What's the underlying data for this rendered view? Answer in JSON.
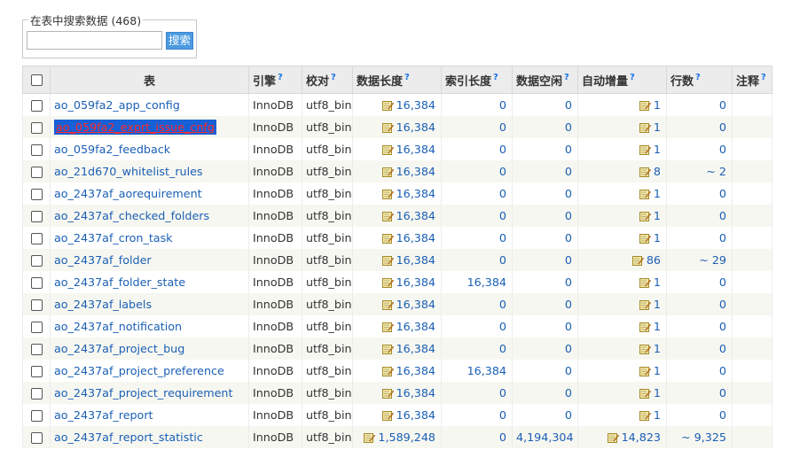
{
  "search": {
    "legend": "在表中搜索数据 (468)",
    "input_value": "",
    "button_label": "搜索"
  },
  "table": {
    "headers": {
      "table": "表",
      "engine": "引擎",
      "collation": "校对",
      "data_length": "数据长度",
      "index_length": "索引长度",
      "data_free": "数据空闲",
      "auto_increment": "自动增量",
      "rows": "行数",
      "comment": "注释"
    },
    "help_mark": "?",
    "rows": [
      {
        "name": "ao_059fa2_app_config",
        "engine": "InnoDB",
        "collation": "utf8_bin",
        "data_length": "16,384",
        "index_length": "0",
        "data_free": "0",
        "auto_increment": "1",
        "rows": "0"
      },
      {
        "name": "ao_059fa2_exprt_issue_cnfg",
        "engine": "InnoDB",
        "collation": "utf8_bin",
        "data_length": "16,384",
        "index_length": "0",
        "data_free": "0",
        "auto_increment": "1",
        "rows": "0"
      },
      {
        "name": "ao_059fa2_feedback",
        "engine": "InnoDB",
        "collation": "utf8_bin",
        "data_length": "16,384",
        "index_length": "0",
        "data_free": "0",
        "auto_increment": "1",
        "rows": "0"
      },
      {
        "name": "ao_21d670_whitelist_rules",
        "engine": "InnoDB",
        "collation": "utf8_bin",
        "data_length": "16,384",
        "index_length": "0",
        "data_free": "0",
        "auto_increment": "8",
        "rows": "~ 2"
      },
      {
        "name": "ao_2437af_aorequirement",
        "engine": "InnoDB",
        "collation": "utf8_bin",
        "data_length": "16,384",
        "index_length": "0",
        "data_free": "0",
        "auto_increment": "1",
        "rows": "0"
      },
      {
        "name": "ao_2437af_checked_folders",
        "engine": "InnoDB",
        "collation": "utf8_bin",
        "data_length": "16,384",
        "index_length": "0",
        "data_free": "0",
        "auto_increment": "1",
        "rows": "0"
      },
      {
        "name": "ao_2437af_cron_task",
        "engine": "InnoDB",
        "collation": "utf8_bin",
        "data_length": "16,384",
        "index_length": "0",
        "data_free": "0",
        "auto_increment": "1",
        "rows": "0"
      },
      {
        "name": "ao_2437af_folder",
        "engine": "InnoDB",
        "collation": "utf8_bin",
        "data_length": "16,384",
        "index_length": "0",
        "data_free": "0",
        "auto_increment": "86",
        "rows": "~ 29"
      },
      {
        "name": "ao_2437af_folder_state",
        "engine": "InnoDB",
        "collation": "utf8_bin",
        "data_length": "16,384",
        "index_length": "16,384",
        "data_free": "0",
        "auto_increment": "1",
        "rows": "0"
      },
      {
        "name": "ao_2437af_labels",
        "engine": "InnoDB",
        "collation": "utf8_bin",
        "data_length": "16,384",
        "index_length": "0",
        "data_free": "0",
        "auto_increment": "1",
        "rows": "0"
      },
      {
        "name": "ao_2437af_notification",
        "engine": "InnoDB",
        "collation": "utf8_bin",
        "data_length": "16,384",
        "index_length": "0",
        "data_free": "0",
        "auto_increment": "1",
        "rows": "0"
      },
      {
        "name": "ao_2437af_project_bug",
        "engine": "InnoDB",
        "collation": "utf8_bin",
        "data_length": "16,384",
        "index_length": "0",
        "data_free": "0",
        "auto_increment": "1",
        "rows": "0"
      },
      {
        "name": "ao_2437af_project_preference",
        "engine": "InnoDB",
        "collation": "utf8_bin",
        "data_length": "16,384",
        "index_length": "16,384",
        "data_free": "0",
        "auto_increment": "1",
        "rows": "0"
      },
      {
        "name": "ao_2437af_project_requirement",
        "engine": "InnoDB",
        "collation": "utf8_bin",
        "data_length": "16,384",
        "index_length": "0",
        "data_free": "0",
        "auto_increment": "1",
        "rows": "0"
      },
      {
        "name": "ao_2437af_report",
        "engine": "InnoDB",
        "collation": "utf8_bin",
        "data_length": "16,384",
        "index_length": "0",
        "data_free": "0",
        "auto_increment": "1",
        "rows": "0"
      },
      {
        "name": "ao_2437af_report_statistic",
        "engine": "InnoDB",
        "collation": "utf8_bin",
        "data_length": "1,589,248",
        "index_length": "0",
        "data_free": "4,194,304",
        "auto_increment": "14,823",
        "rows": "~ 9,325"
      }
    ]
  },
  "selected_row_index": 1,
  "icons": {
    "edit": "edit-pencil-icon"
  },
  "colors": {
    "link": "#1a5fb4",
    "selection_bg": "#1660d8",
    "selection_text": "#ff2a2a",
    "button": "#4c9ae0"
  }
}
